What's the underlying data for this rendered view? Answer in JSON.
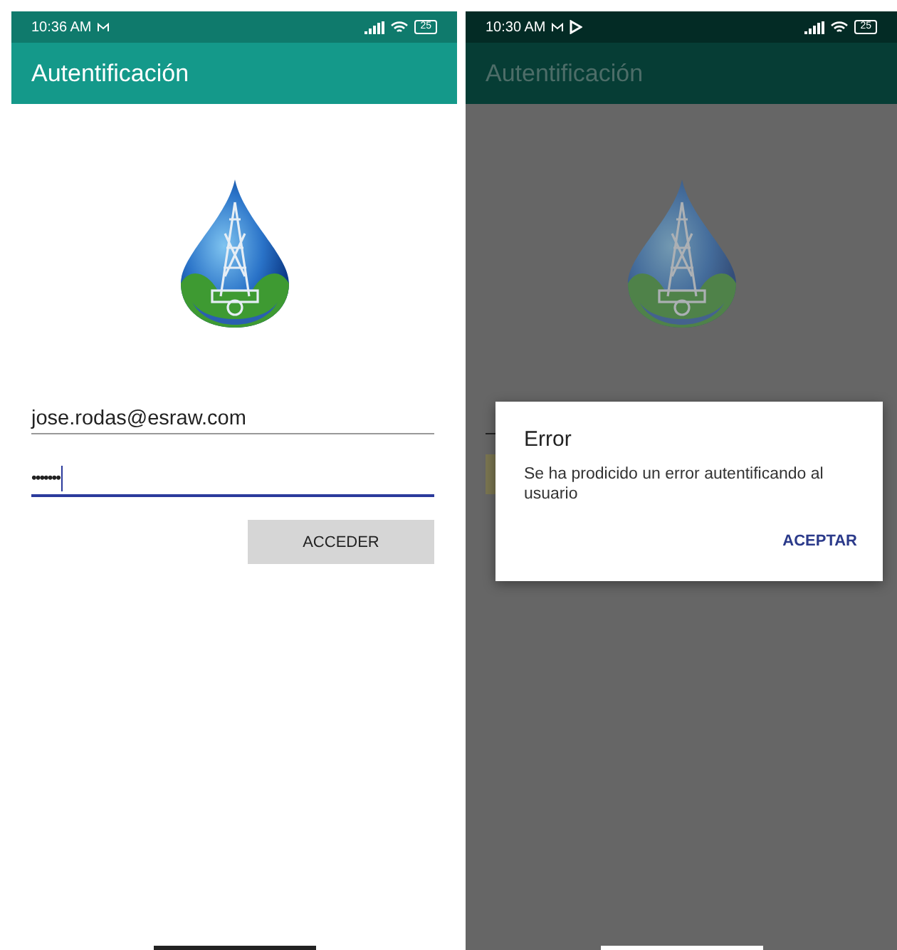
{
  "screens": [
    {
      "kind": "login",
      "dimmed": false,
      "status_bar": {
        "time": "10:36 AM",
        "battery": "25",
        "cast_icon": false
      },
      "app_bar": {
        "title": "Autentificación"
      },
      "email_field": {
        "value": "jose.rodas@esraw.com"
      },
      "password_field": {
        "value": "•••••••",
        "focused": true
      },
      "submit_button": {
        "label": "ACCEDER"
      }
    },
    {
      "kind": "error",
      "dimmed": true,
      "status_bar": {
        "time": "10:30 AM",
        "battery": "25",
        "cast_icon": true
      },
      "app_bar": {
        "title": "Autentificación"
      },
      "dialog": {
        "title": "Error",
        "message": "Se ha prodicido un error autentificando al usuario",
        "button": "ACEPTAR"
      }
    }
  ]
}
